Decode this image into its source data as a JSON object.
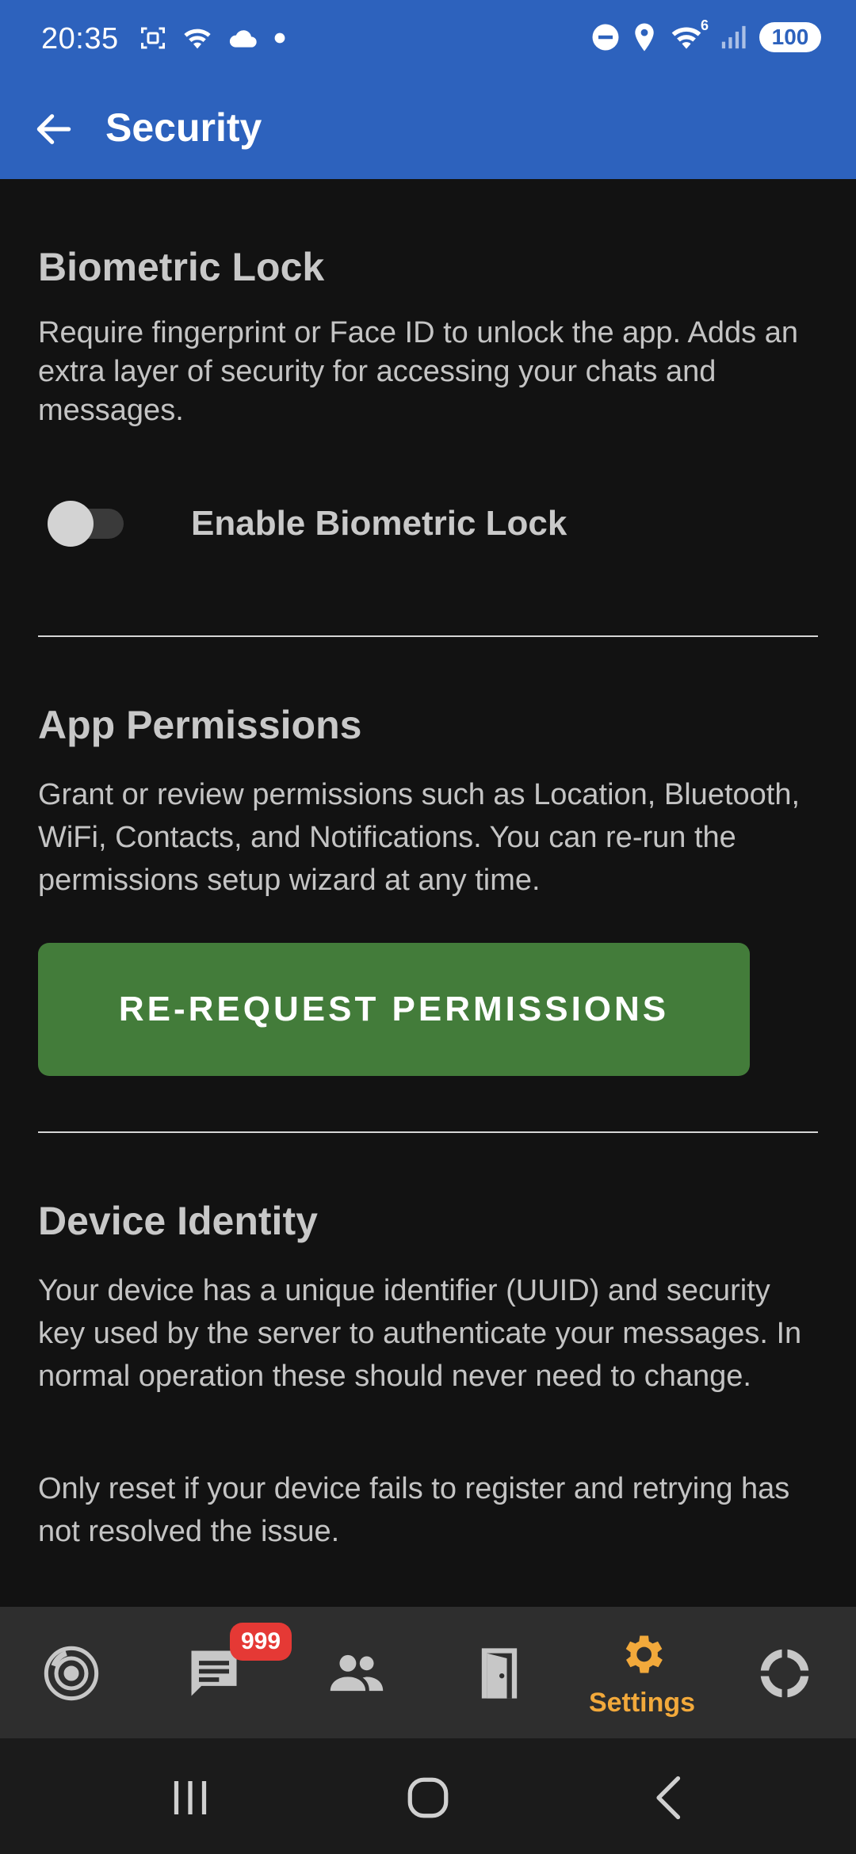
{
  "status_bar": {
    "time": "20:35",
    "battery": "100",
    "network_sub": "6",
    "icons": [
      "screenshot-icon",
      "wifi-icon",
      "cloud-icon",
      "dot-icon",
      "do-not-disturb-icon",
      "location-icon",
      "wifi-data-icon",
      "signal-icon",
      "battery-icon"
    ]
  },
  "app_bar": {
    "title": "Security",
    "back_icon": "back-arrow-icon"
  },
  "biometric": {
    "title": "Biometric Lock",
    "description": "Require fingerprint or Face ID to unlock the app. Adds an extra layer of security for accessing your chats and messages.",
    "toggle_label": "Enable Biometric Lock",
    "toggle_on": false
  },
  "permissions": {
    "title": "App Permissions",
    "description": "Grant or review permissions such as Location, Bluetooth, WiFi, Contacts, and Notifications. You can re-run the permissions setup wizard at any time.",
    "button_label": "RE-REQUEST PERMISSIONS"
  },
  "device_identity": {
    "title": "Device Identity",
    "description": "Your device has a unique identifier (UUID) and security key used by the server to authenticate your messages. In normal operation these should never need to change.",
    "note": "Only reset if your device fails to register and retrying has not resolved the issue."
  },
  "bottom_nav": {
    "items": [
      {
        "icon": "radar-icon",
        "label": ""
      },
      {
        "icon": "chat-icon",
        "label": "",
        "badge": "999"
      },
      {
        "icon": "people-icon",
        "label": ""
      },
      {
        "icon": "door-icon",
        "label": ""
      },
      {
        "icon": "gear-icon",
        "label": "Settings",
        "active": true
      },
      {
        "icon": "lifebuoy-icon",
        "label": ""
      }
    ]
  },
  "colors": {
    "header": "#2d62bd",
    "background": "#121212",
    "button": "#437c3a",
    "active_nav": "#f2a93b",
    "badge": "#e53935"
  }
}
